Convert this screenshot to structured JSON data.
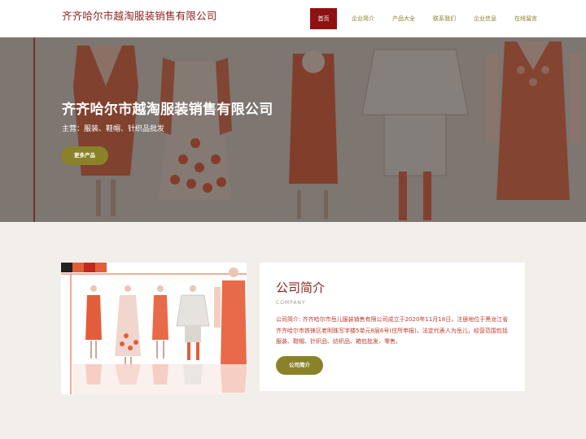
{
  "header": {
    "logo": "齐齐哈尔市越淘服装销售有限公司",
    "nav": [
      "首页",
      "企业简介",
      "产品大全",
      "联系我们",
      "企业信息",
      "在线留言"
    ]
  },
  "hero": {
    "title": "齐齐哈尔市越淘服装销售有限公司",
    "subtitle": "主营：服装、鞋帽、针织品批发",
    "button": "更多产品"
  },
  "about": {
    "title": "公司简介",
    "subtitle_en": "COMPANY",
    "text": "公司简介: 齐齐哈尔市岳儿服装销售有限公司成立于2020年11月18日，注册地位于黑龙江省齐齐哈尔市铁锋区老明珠写字楼5单元8层6号(住所申报)，法定代表人为岳儿，经营范围包括服装、鞋帽、针织品、纺织品、箱包批发、零售。",
    "button": "公司简介"
  },
  "colors": {
    "brand": "#8f1d1d",
    "accent": "#8a8228",
    "nav_active": "#8f1212",
    "background": "#f2efeb"
  }
}
